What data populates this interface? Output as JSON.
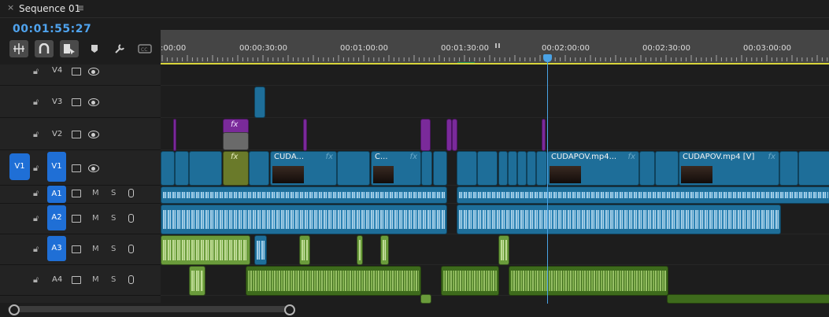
{
  "tab": {
    "close_glyph": "×",
    "title": "Sequence 01",
    "menu_glyph": "≡"
  },
  "timecode": "00:01:55:27",
  "toolbar": [
    {
      "name": "insert-overwrite-icon",
      "active": true
    },
    {
      "name": "snap-magnet-icon",
      "active": true
    },
    {
      "name": "linked-selection-icon",
      "active": true
    },
    {
      "name": "add-marker-icon",
      "active": false
    },
    {
      "name": "wrench-settings-icon",
      "active": false
    },
    {
      "name": "captions-icon",
      "active": false
    }
  ],
  "ruler": {
    "labels": [
      ":00:00",
      "00:00:30:00",
      "00:01:00:00",
      "00:01:30:00",
      "00:02:00:00",
      "00:02:30:00",
      "00:03:00:00"
    ]
  },
  "tracks": {
    "source_patch": "V1",
    "video": [
      {
        "name": "V4"
      },
      {
        "name": "V3"
      },
      {
        "name": "V2"
      },
      {
        "name": "V1",
        "selected": true
      }
    ],
    "audio": [
      {
        "name": "A1",
        "selected": true
      },
      {
        "name": "A2",
        "selected": true
      },
      {
        "name": "A3",
        "selected": true
      },
      {
        "name": "A4",
        "selected": false
      }
    ],
    "mute_label": "M",
    "solo_label": "S"
  },
  "clips": {
    "v1_labels": [
      "CUDA...",
      "C...",
      "CUDAPOV.mp4...",
      "CUDAPOV.mp4 [V]"
    ],
    "fx_label": "fx"
  },
  "colors": {
    "timecode": "#4fa3ee",
    "video_clip": "#1e6e99",
    "audio_green": "#6a9b3b",
    "adjustment_purple": "#7a2a9a",
    "playhead": "#4aa3e6",
    "track_select": "#1f6fd6",
    "work_area": "#d8d43a"
  }
}
